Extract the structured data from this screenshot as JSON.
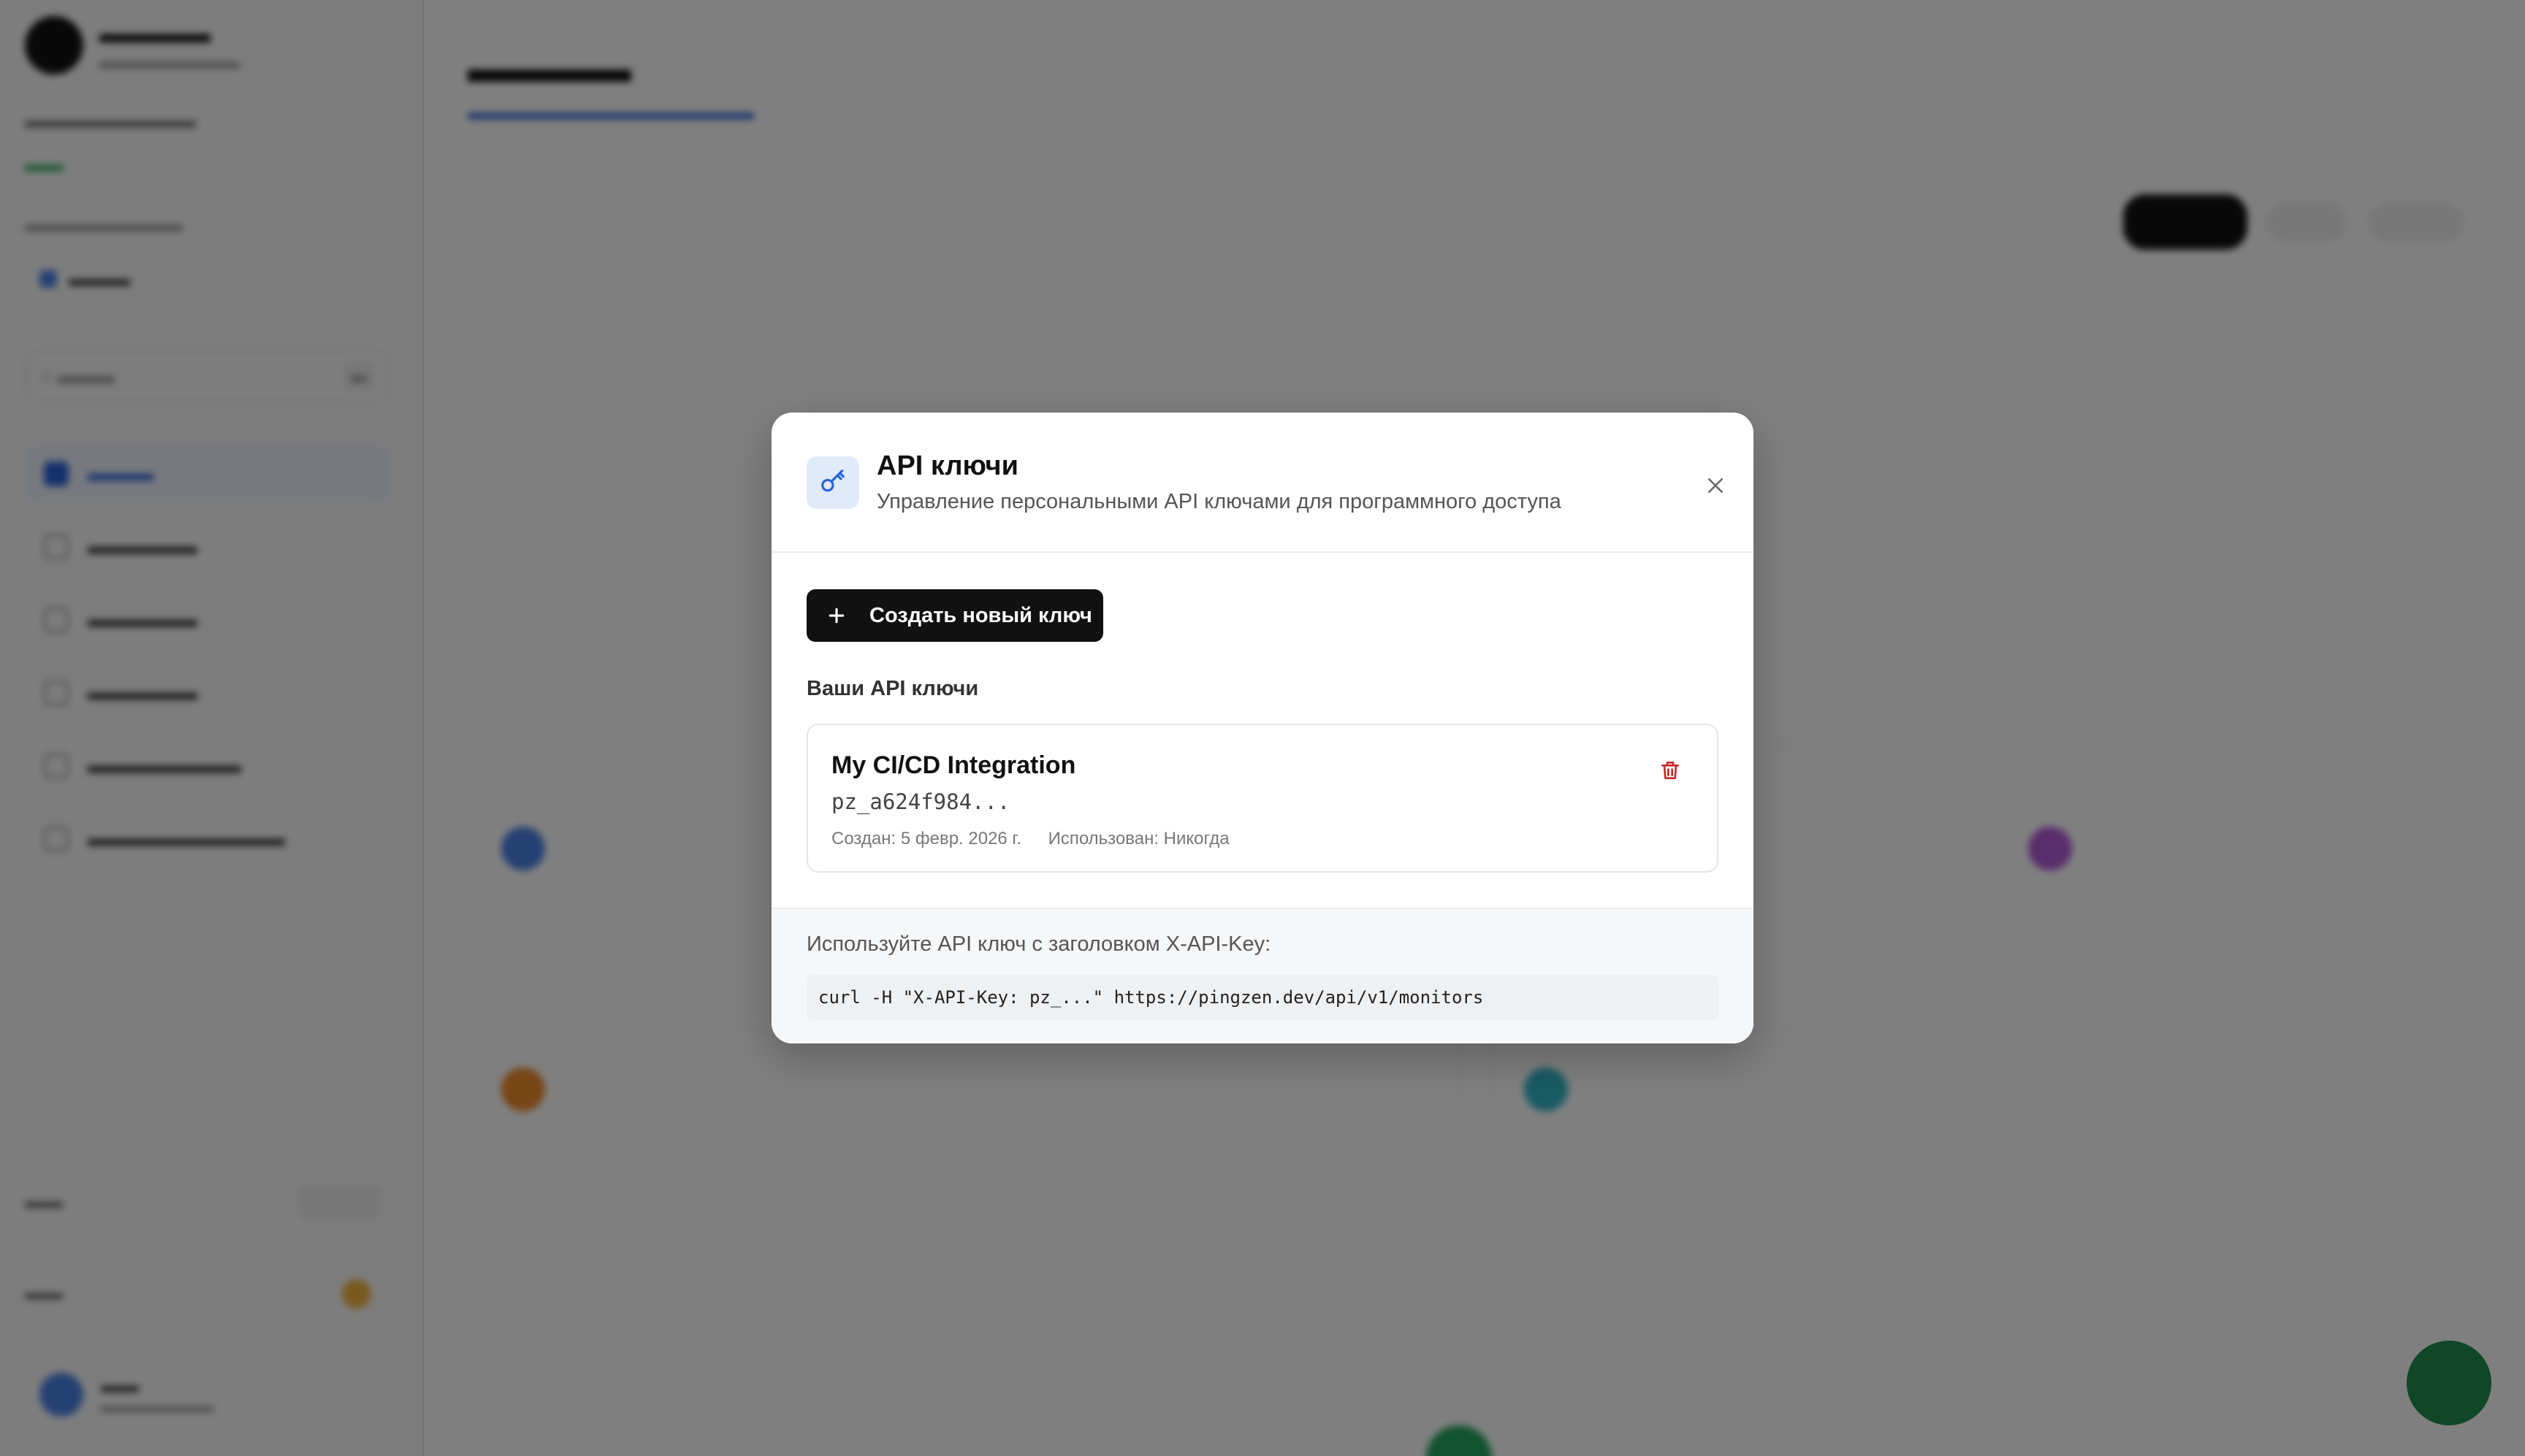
{
  "modal": {
    "title": "API ключи",
    "subtitle": "Управление персональными API ключами для программного доступа",
    "create_button_label": "Создать новый ключ",
    "section_label": "Ваши API ключи",
    "keys": [
      {
        "name": "My CI/CD Integration",
        "key": "pz_a624f984...",
        "created": "Создан: 5 февр. 2026 г.",
        "used": "Использован: Никогда"
      }
    ],
    "footer_text": "Используйте API ключ с заголовком X-API-Key:",
    "code_example": "curl -H \"X-API-Key: pz_...\" https://pingzen.dev/api/v1/monitors",
    "icons": {
      "header": "key-icon",
      "close": "close-icon",
      "create": "plus-icon",
      "delete": "trash-icon"
    }
  },
  "colors": {
    "overlay": "rgba(0,0,0,0.5)",
    "primary_button": "#111111",
    "key_badge_bg": "#dfeafb",
    "key_icon": "#2a62d8",
    "delete_icon": "#c62828"
  }
}
